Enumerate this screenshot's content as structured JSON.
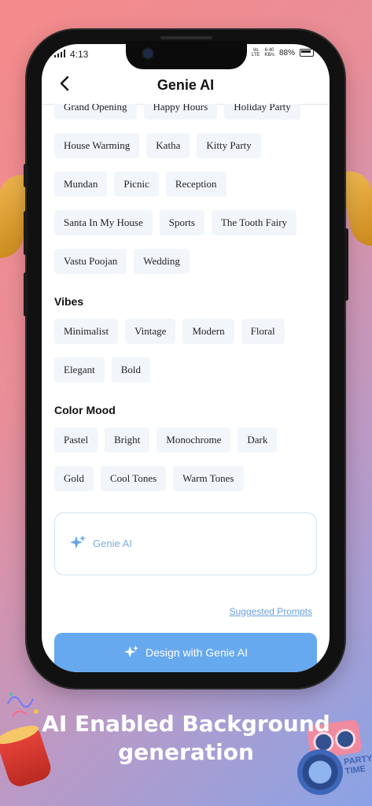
{
  "status": {
    "time": "4:13",
    "net_top": "Vo",
    "net_bottom": "LTE",
    "speed_top": "6.40",
    "speed_bottom": "KB/s",
    "battery": "88%"
  },
  "header": {
    "title": "Genie AI"
  },
  "occasions": [
    "Grand Opening",
    "Happy Hours",
    "Holiday Party",
    "House Warming",
    "Katha",
    "Kitty Party",
    "Mundan",
    "Picnic",
    "Reception",
    "Santa In My House",
    "Sports",
    "The Tooth Fairy",
    "Vastu Poojan",
    "Wedding"
  ],
  "vibes": {
    "title": "Vibes",
    "items": [
      "Minimalist",
      "Vintage",
      "Modern",
      "Floral",
      "Elegant",
      "Bold"
    ]
  },
  "color_mood": {
    "title": "Color Mood",
    "items": [
      "Pastel",
      "Bright",
      "Monochrome",
      "Dark",
      "Gold",
      "Cool Tones",
      "Warm Tones"
    ]
  },
  "prompt": {
    "placeholder": "Genie AI"
  },
  "suggested_link": "Suggested Prompts",
  "design_button": "Design with Genie AI",
  "promo": {
    "line1": "AI Enabled Background",
    "line2": "generation"
  },
  "decor": {
    "party_line1": "PARTY",
    "party_line2": "TIME"
  },
  "colors": {
    "accent": "#66a9ef",
    "chip_bg": "#f2f6fb",
    "link": "#6a9fdc"
  }
}
